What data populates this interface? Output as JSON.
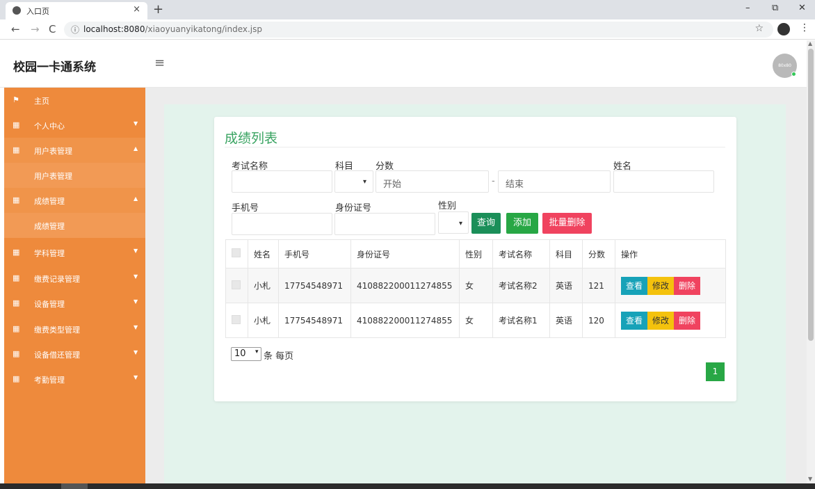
{
  "browser": {
    "tab_title": "入口页",
    "close_glyph": "×",
    "newtab_glyph": "+",
    "url_host": "localhost:8080",
    "url_path": "/xiaoyuanyikatong/index.jsp",
    "back": "←",
    "forward": "→",
    "reload": "C",
    "info_icon": "ⓘ",
    "star": "☆",
    "menu": "⋮",
    "minimize": "–",
    "restore": "⧉",
    "close": "✕"
  },
  "header": {
    "brand": "校园一卡通系统",
    "hamburger": "≡",
    "avatar_text": "80x80"
  },
  "sidebar": {
    "items": [
      {
        "label": "主页",
        "icon": "flag-icon"
      },
      {
        "label": "个人中心",
        "icon": "grid-icon"
      },
      {
        "label": "用户表管理",
        "icon": "grid-icon"
      },
      {
        "label": "用户表管理",
        "sub": true
      },
      {
        "label": "成绩管理",
        "icon": "grid-icon"
      },
      {
        "label": "成绩管理",
        "sub": true
      },
      {
        "label": "学科管理",
        "icon": "grid-icon"
      },
      {
        "label": "缴费记录管理",
        "icon": "grid-icon"
      },
      {
        "label": "设备管理",
        "icon": "grid-icon"
      },
      {
        "label": "缴费类型管理",
        "icon": "grid-icon"
      },
      {
        "label": "设备借还管理",
        "icon": "grid-icon"
      },
      {
        "label": "考勤管理",
        "icon": "grid-icon"
      }
    ]
  },
  "page": {
    "title": "成绩列表"
  },
  "filters": {
    "exam_name_label": "考试名称",
    "subject_label": "科目",
    "score_label": "分数",
    "score_start_placeholder": "开始",
    "score_dash": "-",
    "score_end_placeholder": "结束",
    "name_label": "姓名",
    "phone_label": "手机号",
    "idcard_label": "身份证号",
    "gender_label": "性别",
    "search_button": "查询",
    "add_button": "添加",
    "batch_delete_button": "批量删除"
  },
  "table": {
    "headers": [
      "姓名",
      "手机号",
      "身份证号",
      "性别",
      "考试名称",
      "科目",
      "分数",
      "操作"
    ],
    "rows": [
      {
        "name": "小札",
        "phone": "17754548971",
        "idcard": "410882200011274855",
        "gender": "女",
        "exam": "考试名称2",
        "subject": "英语",
        "score": "121"
      },
      {
        "name": "小札",
        "phone": "17754548971",
        "idcard": "410882200011274855",
        "gender": "女",
        "exam": "考试名称1",
        "subject": "英语",
        "score": "120"
      }
    ],
    "actions": {
      "view": "查看",
      "edit": "修改",
      "delete": "删除"
    }
  },
  "pagination": {
    "page_size": "10",
    "page_size_label": "条 每页",
    "current_page": "1"
  }
}
